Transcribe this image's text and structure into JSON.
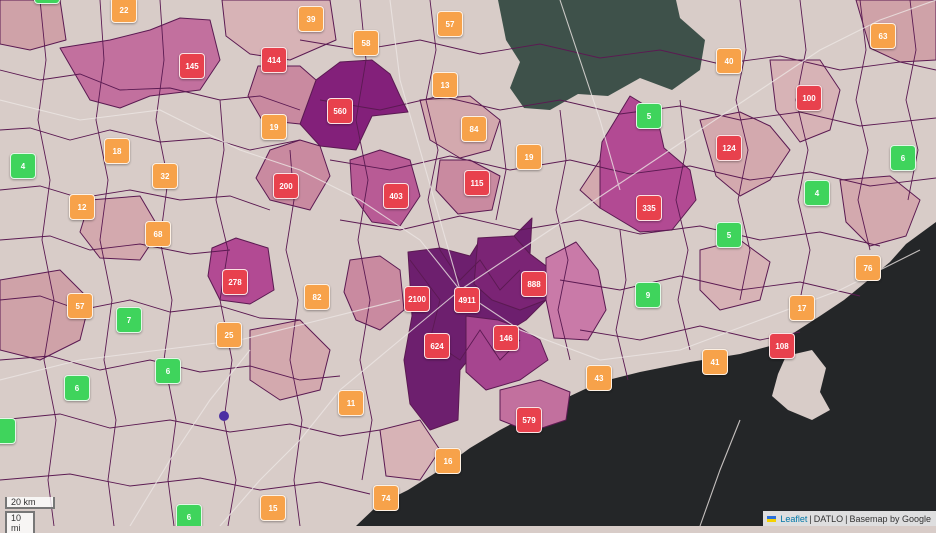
{
  "map": {
    "colors": {
      "land": "#d8ccc8",
      "sea": "#242628",
      "forest": "#3e514a",
      "border": "#5b1a52",
      "marker_green": "#3fd45c",
      "marker_orange": "#f7a24a",
      "marker_red": "#e8414d"
    },
    "markers": [
      {
        "label": "22",
        "color": "orange"
      },
      {
        "label": "39",
        "color": "orange"
      },
      {
        "label": "57",
        "color": "orange"
      },
      {
        "label": "63",
        "color": "orange"
      },
      {
        "label": "145",
        "color": "red"
      },
      {
        "label": "414",
        "color": "red"
      },
      {
        "label": "58",
        "color": "orange"
      },
      {
        "label": "40",
        "color": "orange"
      },
      {
        "label": "13",
        "color": "orange"
      },
      {
        "label": "560",
        "color": "red"
      },
      {
        "label": "100",
        "color": "red"
      },
      {
        "label": "5",
        "color": "green"
      },
      {
        "label": "19",
        "color": "orange"
      },
      {
        "label": "84",
        "color": "orange"
      },
      {
        "label": "18",
        "color": "orange"
      },
      {
        "label": "124",
        "color": "red"
      },
      {
        "label": "4",
        "color": "green"
      },
      {
        "label": "19",
        "color": "orange"
      },
      {
        "label": "6",
        "color": "green"
      },
      {
        "label": "32",
        "color": "orange"
      },
      {
        "label": "200",
        "color": "red"
      },
      {
        "label": "115",
        "color": "red"
      },
      {
        "label": "4",
        "color": "green"
      },
      {
        "label": "403",
        "color": "red"
      },
      {
        "label": "12",
        "color": "orange"
      },
      {
        "label": "335",
        "color": "red"
      },
      {
        "label": "68",
        "color": "orange"
      },
      {
        "label": "5",
        "color": "green"
      },
      {
        "label": "76",
        "color": "orange"
      },
      {
        "label": "278",
        "color": "red"
      },
      {
        "label": "888",
        "color": "red"
      },
      {
        "label": "82",
        "color": "orange"
      },
      {
        "label": "2100",
        "color": "red"
      },
      {
        "label": "4911",
        "color": "red"
      },
      {
        "label": "9",
        "color": "green"
      },
      {
        "label": "57",
        "color": "orange"
      },
      {
        "label": "17",
        "color": "orange"
      },
      {
        "label": "7",
        "color": "green"
      },
      {
        "label": "25",
        "color": "orange"
      },
      {
        "label": "146",
        "color": "red"
      },
      {
        "label": "624",
        "color": "red"
      },
      {
        "label": "108",
        "color": "red"
      },
      {
        "label": "41",
        "color": "orange"
      },
      {
        "label": "6",
        "color": "green"
      },
      {
        "label": "43",
        "color": "orange"
      },
      {
        "label": "6",
        "color": "green"
      },
      {
        "label": "11",
        "color": "orange"
      },
      {
        "label": "579",
        "color": "red"
      },
      {
        "label": "16",
        "color": "orange"
      },
      {
        "label": "74",
        "color": "orange"
      },
      {
        "label": "15",
        "color": "orange"
      },
      {
        "label": "6",
        "color": "green"
      }
    ]
  },
  "scale": {
    "km": "20 km",
    "mi": "10 mi"
  },
  "attribution": {
    "leaflet": "Leaflet",
    "datlo": "DATLO",
    "basemap": "Basemap by Google",
    "sep": "|"
  }
}
